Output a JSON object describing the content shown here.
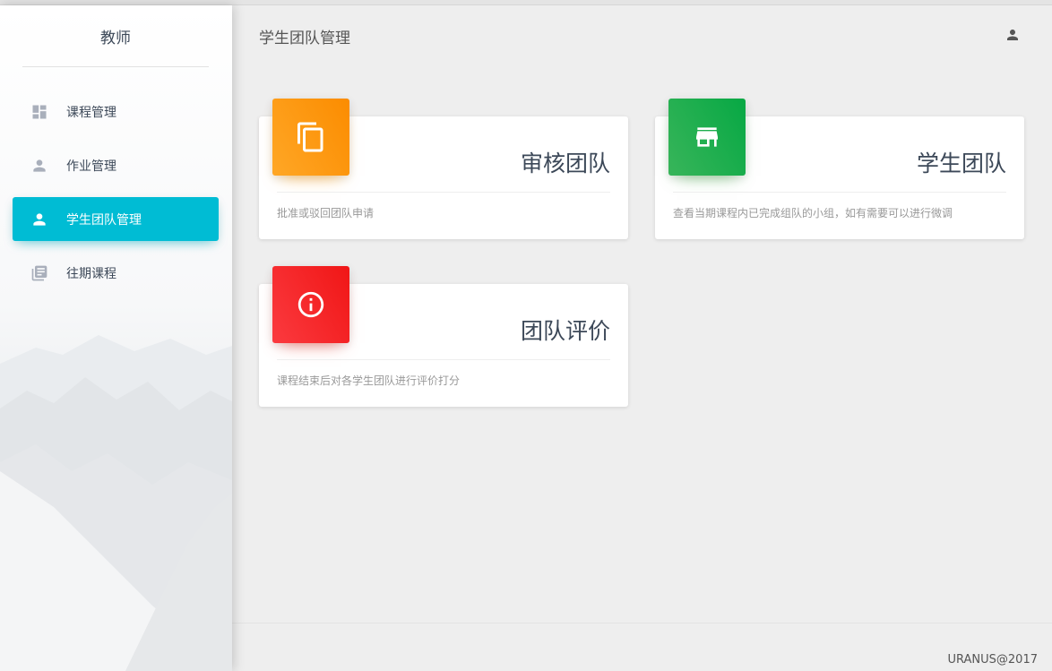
{
  "sidebar": {
    "brand": "教师",
    "items": [
      {
        "label": "课程管理",
        "icon": "dashboard-icon",
        "active": false
      },
      {
        "label": "作业管理",
        "icon": "person-icon",
        "active": false
      },
      {
        "label": "学生团队管理",
        "icon": "person-icon",
        "active": true
      },
      {
        "label": "往期课程",
        "icon": "library-books-icon",
        "active": false
      }
    ]
  },
  "header": {
    "title": "学生团队管理",
    "user_icon": "person-icon"
  },
  "cards": [
    {
      "title": "审核团队",
      "description": "批准或驳回团队申请",
      "icon": "content-copy-icon",
      "color": "#fb8c00"
    },
    {
      "title": "学生团队",
      "description": "查看当期课程内已完成组队的小组，如有需要可以进行微调",
      "icon": "store-icon",
      "color": "#43a047"
    },
    {
      "title": "团队评价",
      "description": "课程结束后对各学生团队进行评价打分",
      "icon": "info-outline-icon",
      "color": "#e53935"
    }
  ],
  "footer": {
    "text": "URANUS@2017"
  },
  "colors": {
    "accent": "#00bcd4",
    "background": "#eeeeee"
  }
}
